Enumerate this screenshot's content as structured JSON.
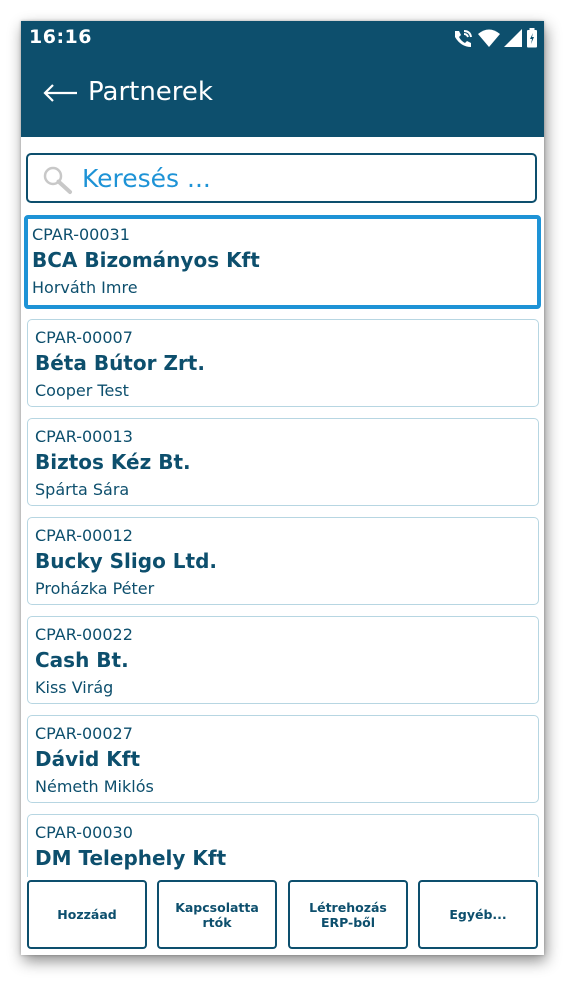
{
  "status": {
    "time": "16:16"
  },
  "header": {
    "title": "Partnerek"
  },
  "search": {
    "placeholder": "Keresés ..."
  },
  "partners": [
    {
      "code": "CPAR-00031",
      "name": "BCA Bizományos Kft",
      "contact": "Horváth Imre",
      "selected": true
    },
    {
      "code": "CPAR-00007",
      "name": "Béta Bútor Zrt.",
      "contact": "Cooper Test"
    },
    {
      "code": "CPAR-00013",
      "name": "Biztos Kéz Bt.",
      "contact": "Spárta Sára"
    },
    {
      "code": "CPAR-00012",
      "name": "Bucky Sligo Ltd.",
      "contact": "Proházka Péter"
    },
    {
      "code": "CPAR-00022",
      "name": "Cash Bt.",
      "contact": "Kiss Virág"
    },
    {
      "code": "CPAR-00027",
      "name": "Dávid Kft",
      "contact": "Németh Miklós"
    },
    {
      "code": "CPAR-00030",
      "name": "DM Telephely Kft",
      "contact": ""
    }
  ],
  "actions": {
    "add": "Hozzáad",
    "contacts": "Kapcsolatta rtók",
    "create_erp": "Létrehozás ERP-ből",
    "other": "Egyéb..."
  },
  "colors": {
    "primary": "#0d4f6d",
    "accent": "#1e93d6",
    "card_border": "#b7d6e2"
  }
}
